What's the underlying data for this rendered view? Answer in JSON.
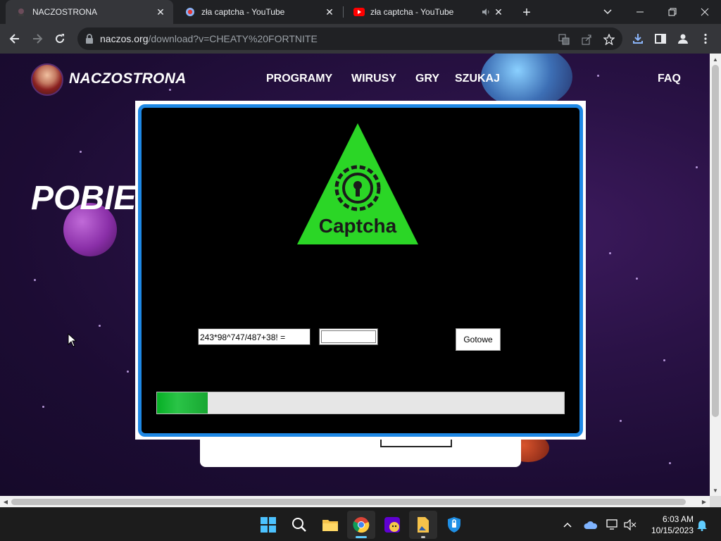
{
  "browser": {
    "tabs": [
      {
        "title": "NACZOSTRONA",
        "active": true
      },
      {
        "title": "zła captcha - YouTube",
        "active": false
      },
      {
        "title": "zła captcha - YouTube",
        "active": false
      }
    ],
    "url_domain": "naczos.org",
    "url_path": "/download?v=CHEATY%20FORTNITE"
  },
  "site": {
    "name": "NACZOSTRONA",
    "nav": [
      "PROGRAMY",
      "WIRUSY",
      "GRY",
      "SZUKAJ"
    ],
    "faq": "FAQ",
    "hero_title": "POBIE"
  },
  "captcha": {
    "logo_text": "Captcha",
    "logo_color": "#2bd626",
    "equation": "243*98^747/487+38! =",
    "answer_value": "",
    "submit_label": "Gotowe",
    "progress_percent": 12.5,
    "progress_color": "#06b025",
    "frame_color": "#1e88e5"
  },
  "taskbar": {
    "time": "6:03 AM",
    "date": "10/15/2023",
    "apps": [
      "windows-start",
      "search",
      "file-explorer",
      "chrome",
      "yahoo-app",
      "files-app",
      "security-app"
    ]
  }
}
